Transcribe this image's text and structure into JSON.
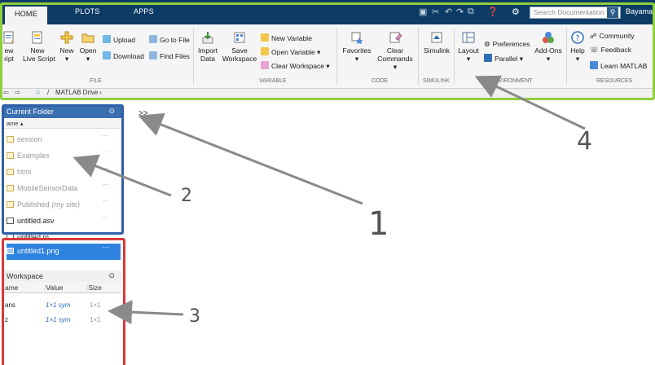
{
  "tabs": {
    "home": "HOME",
    "plots": "PLOTS",
    "apps": "APPS"
  },
  "search": {
    "placeholder": "Search Documentation"
  },
  "user": "Bayaman",
  "ribbon": {
    "file": {
      "new_script": "ew\nript",
      "new_live": "New\nLive Script",
      "new": "New",
      "open": "Open",
      "upload": "Upload",
      "download": "Download",
      "goto": "Go to File",
      "find": "Find Files",
      "label": "FILE"
    },
    "variable": {
      "import": "Import\nData",
      "save_ws": "Save\nWorkspace",
      "new_var": "New Variable",
      "open_var": "Open Variable",
      "clear_ws": "Clear Workspace",
      "label": "VARIABLE"
    },
    "code": {
      "favorites": "Favorites",
      "clear_cmd": "Clear\nCommands",
      "label": "CODE"
    },
    "simulink": {
      "simulink": "Simulink",
      "label": "SIMULINK"
    },
    "environment": {
      "layout": "Layout",
      "preferences": "Preferences",
      "parallel": "Parallel",
      "addons": "Add-Ons",
      "label": "ENVIRONMENT"
    },
    "resources": {
      "help": "Help",
      "community": "Community",
      "feedback": "Feedback",
      "learn": "Learn MATLAB",
      "label": "RESOURCES"
    }
  },
  "address": {
    "path": "MATLAB Drive"
  },
  "current_folder": {
    "title": "Current Folder",
    "col_name": "ame",
    "items": [
      {
        "name": "session",
        "dark": false
      },
      {
        "name": "Examples",
        "dark": false
      },
      {
        "name": "html",
        "dark": false
      },
      {
        "name": "MobileSensorData",
        "dark": false
      },
      {
        "name": "Published",
        "suffix": "(my site)",
        "dark": false
      },
      {
        "name": "untitled.asv",
        "dark": true
      },
      {
        "name": "untitled.m",
        "dark": true
      },
      {
        "name": "untitled1.png",
        "dark": true
      }
    ]
  },
  "workspace": {
    "title": "Workspace",
    "headers": [
      "ame",
      "Value",
      "Size"
    ],
    "rows": [
      {
        "name": "ans",
        "value": "1×1 sym",
        "size": "1×1"
      },
      {
        "name": "z",
        "value": "1×1 sym",
        "size": "1×1"
      }
    ]
  },
  "command_window": {
    "prompt": ">>"
  },
  "annotations": [
    "1",
    "2",
    "3",
    "4"
  ],
  "colors": {
    "ribbon_frame": "#8fcf3a",
    "folder_frame": "#2f5fa8",
    "workspace_frame": "#d83a3a",
    "titlebar": "#0c3c66"
  }
}
